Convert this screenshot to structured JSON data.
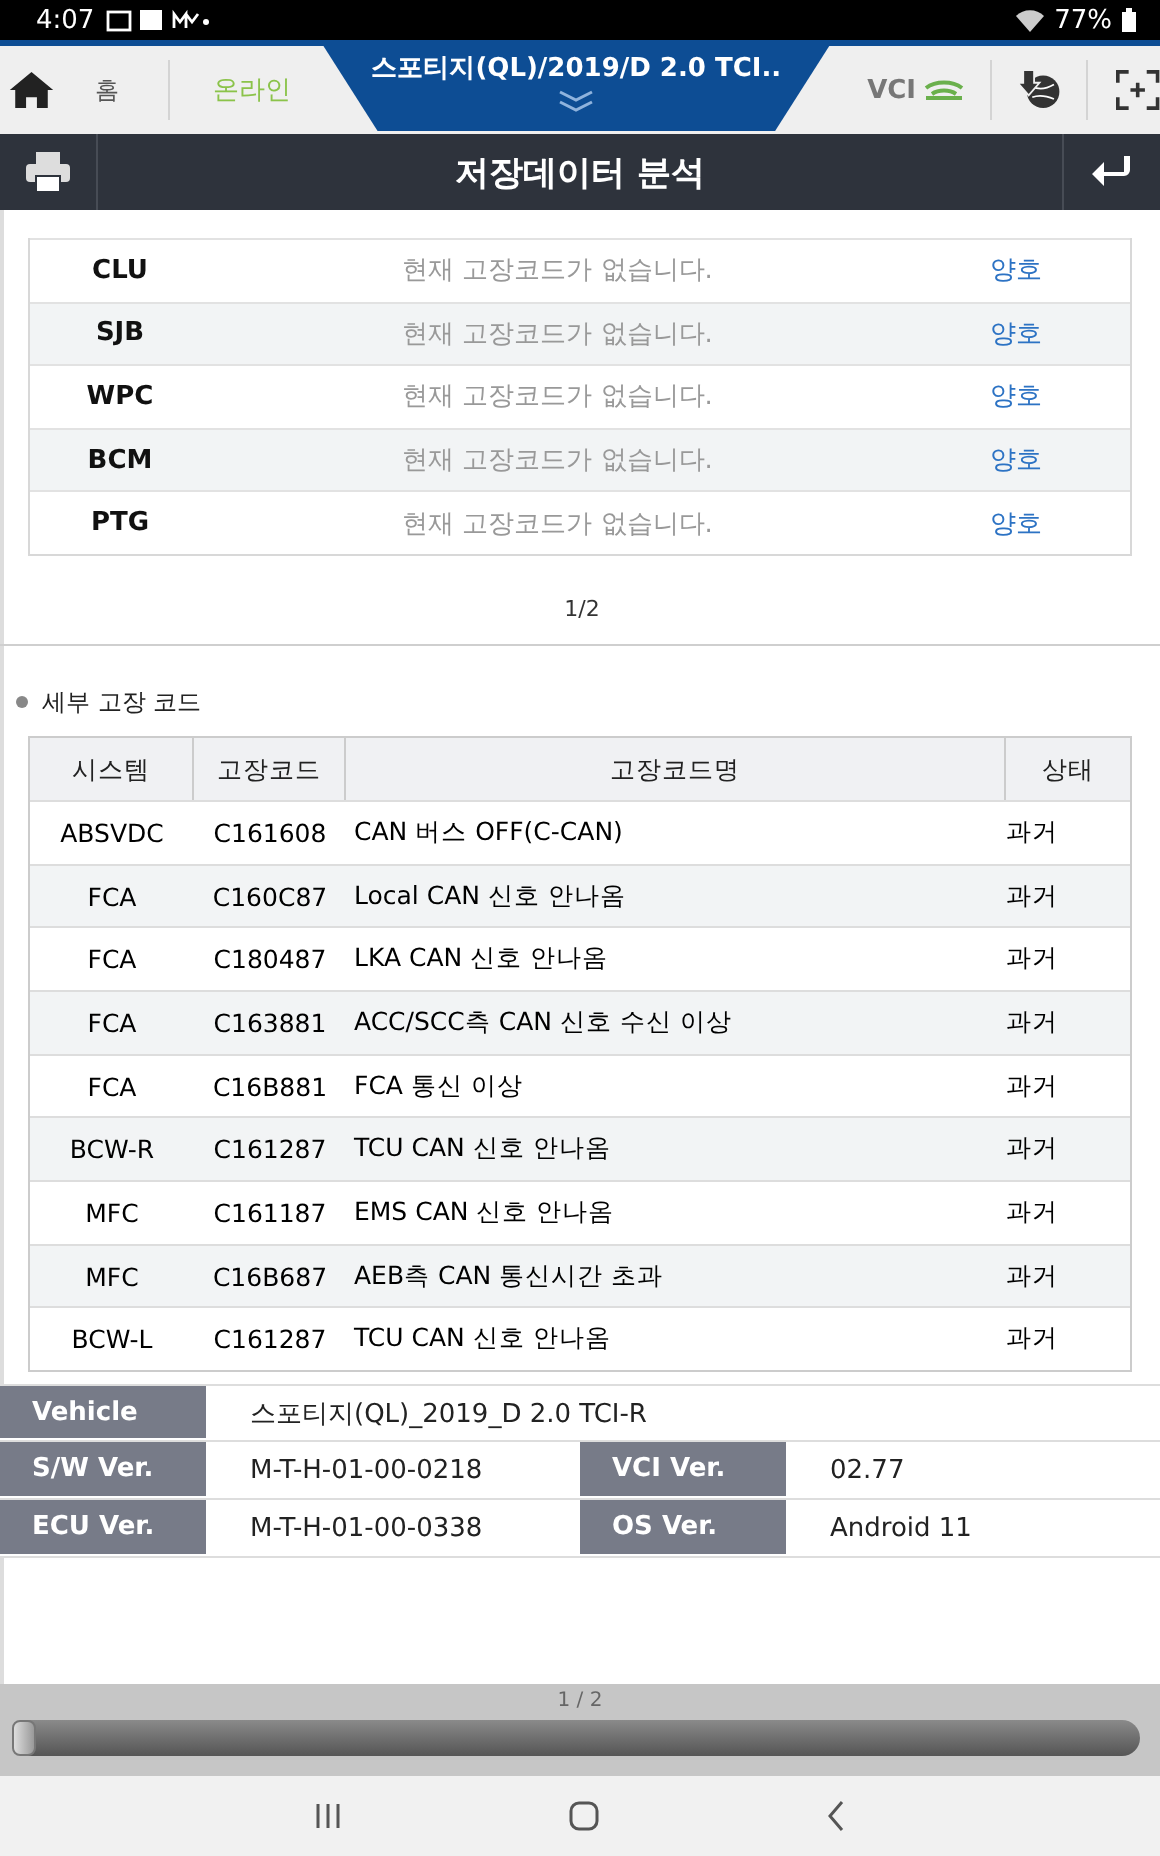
{
  "status_bar": {
    "time": "4:07",
    "battery": "77%"
  },
  "header": {
    "home_label": "홈",
    "connection": "온라인",
    "vehicle": "스포티지(QL)/2019/D 2.0 TCI..",
    "vci": "VCI"
  },
  "title": "저장데이터 분석",
  "system_status": {
    "rows": [
      {
        "system": "CLU",
        "message": "현재 고장코드가 없습니다.",
        "status": "양호"
      },
      {
        "system": "SJB",
        "message": "현재 고장코드가 없습니다.",
        "status": "양호"
      },
      {
        "system": "WPC",
        "message": "현재 고장코드가 없습니다.",
        "status": "양호"
      },
      {
        "system": "BCM",
        "message": "현재 고장코드가 없습니다.",
        "status": "양호"
      },
      {
        "system": "PTG",
        "message": "현재 고장코드가 없습니다.",
        "status": "양호"
      }
    ],
    "pager": "1/2"
  },
  "section_title": "세부 고장 코드",
  "dtc_table": {
    "columns": [
      "시스템",
      "고장코드",
      "고장코드명",
      "상태"
    ],
    "rows": [
      [
        "ABSVDC",
        "C161608",
        "CAN 버스 OFF(C-CAN)",
        "과거"
      ],
      [
        "FCA",
        "C160C87",
        "Local CAN 신호 안나옴",
        "과거"
      ],
      [
        "FCA",
        "C180487",
        "LKA CAN 신호 안나옴",
        "과거"
      ],
      [
        "FCA",
        "C163881",
        "ACC/SCC측 CAN 신호 수신 이상",
        "과거"
      ],
      [
        "FCA",
        "C16B881",
        "FCA 통신 이상",
        "과거"
      ],
      [
        "BCW-R",
        "C161287",
        "TCU CAN 신호 안나옴",
        "과거"
      ],
      [
        "MFC",
        "C161187",
        "EMS CAN 신호 안나옴",
        "과거"
      ],
      [
        "MFC",
        "C16B687",
        "AEB측 CAN 통신시간 초과",
        "과거"
      ],
      [
        "BCW-L",
        "C161287",
        "TCU CAN 신호 안나옴",
        "과거"
      ]
    ]
  },
  "info": [
    [
      {
        "label": "Vehicle",
        "value": "스포티지(QL)_2019_D 2.0 TCI-R"
      }
    ],
    [
      {
        "label": "S/W Ver.",
        "value": "M-T-H-01-00-0218"
      },
      {
        "label": "VCI Ver.",
        "value": "02.77"
      }
    ],
    [
      {
        "label": "ECU Ver.",
        "value": "M-T-H-01-00-0338"
      },
      {
        "label": "OS Ver.",
        "value": "Android 11"
      }
    ]
  ],
  "slider": {
    "label": "1 / 2",
    "level": 0
  }
}
